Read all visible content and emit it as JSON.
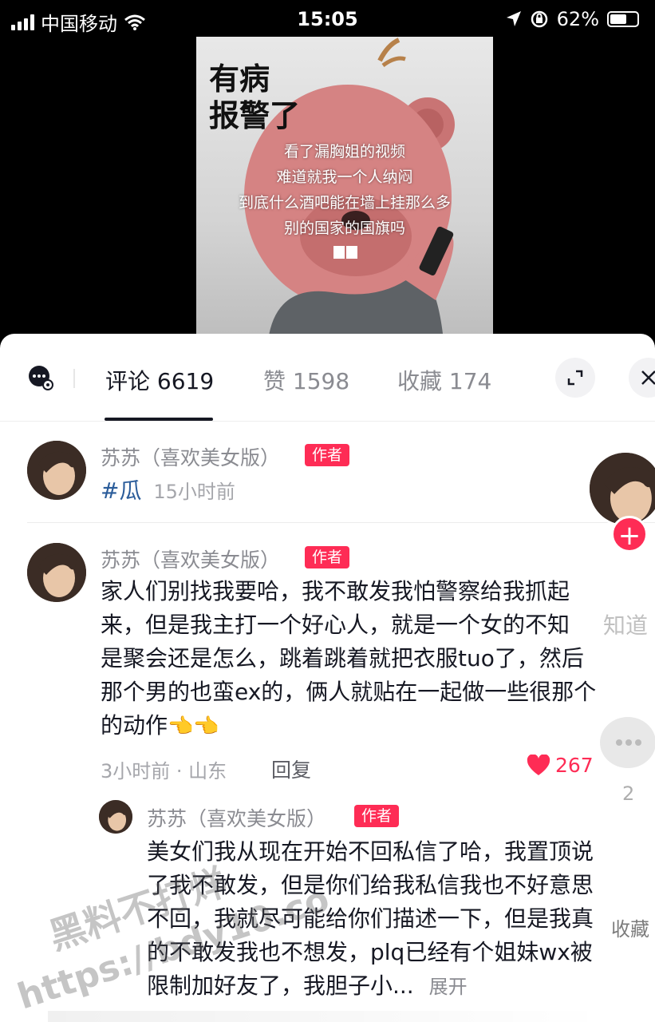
{
  "status_bar": {
    "carrier": "中国移动",
    "time": "15:05",
    "battery": "62%",
    "battery_level": 0.62
  },
  "video": {
    "title_line1": "有病",
    "title_line2": "报警了",
    "caption": [
      "看了漏胸姐的视频",
      "难道就我一个人纳闷",
      "到底什么酒吧能在墙上挂那么多",
      "别的国家的国旗吗"
    ]
  },
  "tabs": [
    {
      "label": "评论 6619",
      "active": true
    },
    {
      "label": "赞 1598",
      "active": false
    },
    {
      "label": "收藏 174",
      "active": false
    }
  ],
  "comments": [
    {
      "user": "苏苏（喜欢美女版）",
      "badge": "作者",
      "tag": "#瓜",
      "time": "15小时前"
    },
    {
      "user": "苏苏（喜欢美女版）",
      "badge": "作者",
      "lines": [
        "家人们别找我要哈，我不敢发我怕警察给我抓起",
        "来，但是我主打一个好心人，就是一个女的不知",
        "是聚会还是怎么，跳着跳着就把衣服tuo了，然后",
        "那个男的也蛮ex的，俩人就贴在一起做一些很那个",
        "的动作"
      ],
      "emoji": "👈👈",
      "meta": "3小时前 · 山东",
      "reply": "回复",
      "likes": "267"
    },
    {
      "user": "苏苏（喜欢美女版）",
      "badge": "作者",
      "lines": [
        "美女们我从现在开始不回私信了哈，我置顶说",
        "了我不敢发，但是你们给我私信我也不好意思",
        "不回，我就尽可能给你们描述一下，但是我真",
        "的不敢发我也不想发，plq已经有个姐妹wx被",
        "限制加好友了，我胆子小..."
      ],
      "expand": "展开"
    }
  ],
  "side": {
    "share_count": "2",
    "collect_label": "收藏",
    "faint_text": "知道"
  },
  "watermark": {
    "line1": "黑料不打烊",
    "line2": "https://bdy10.co"
  },
  "colors": {
    "accent": "#fe2c55",
    "tag": "#2a5c9a",
    "text": "#161823",
    "muted": "#8a8b91"
  }
}
